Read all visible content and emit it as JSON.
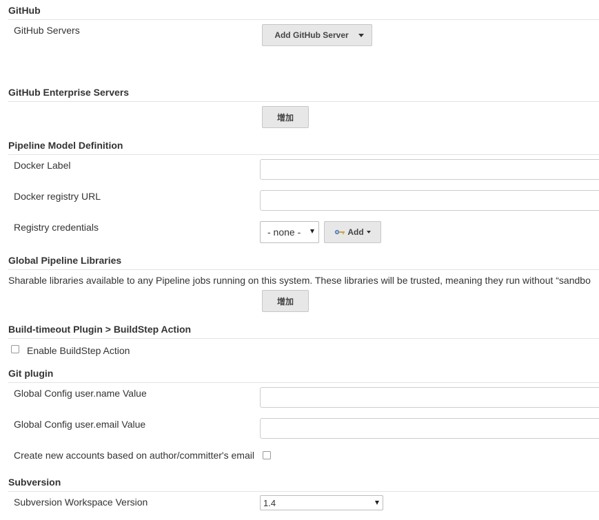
{
  "github": {
    "heading": "GitHub",
    "servers_label": "GitHub Servers",
    "add_server_button": "Add GitHub Server"
  },
  "github_enterprise": {
    "heading": "GitHub Enterprise Servers",
    "add_button": "增加"
  },
  "pipeline_model": {
    "heading": "Pipeline Model Definition",
    "docker_label": "Docker Label",
    "docker_label_value": "",
    "registry_url_label": "Docker registry URL",
    "registry_url_value": "",
    "credentials_label": "Registry credentials",
    "credentials_selected": "- none -",
    "credentials_add_button": "Add"
  },
  "global_libraries": {
    "heading": "Global Pipeline Libraries",
    "description": "Sharable libraries available to any Pipeline jobs running on this system. These libraries will be trusted, meaning they run without “sandbo",
    "add_button": "增加"
  },
  "build_timeout": {
    "heading": "Build-timeout Plugin > BuildStep Action",
    "enable_label": "Enable BuildStep Action",
    "enable_checked": false
  },
  "git_plugin": {
    "heading": "Git plugin",
    "user_name_label": "Global Config user.name Value",
    "user_name_value": "",
    "user_email_label": "Global Config user.email Value",
    "user_email_value": "",
    "create_accounts_label": "Create new accounts based on author/committer's email",
    "create_accounts_checked": false
  },
  "subversion": {
    "heading": "Subversion",
    "workspace_version_label": "Subversion Workspace Version",
    "workspace_version_selected": "1.4"
  },
  "icons": {
    "key_icon": "key-icon",
    "dropdown_icon": "chevron-down-icon"
  }
}
